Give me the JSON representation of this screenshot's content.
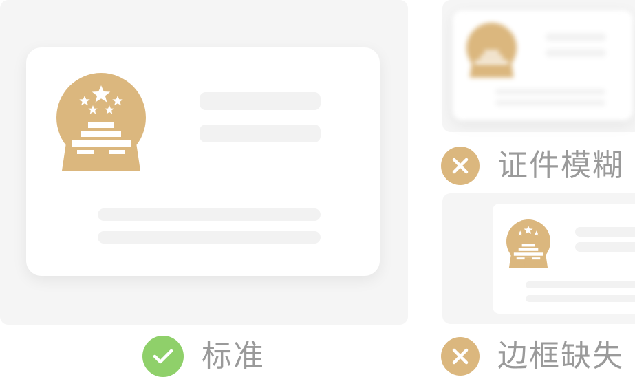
{
  "colors": {
    "gold": "#dbb77e",
    "valid_green": "#8fd06a",
    "panel_gray": "#f5f5f5",
    "bar_gray": "#f2f2f2",
    "label_gray": "#9a9a9a"
  },
  "examples": {
    "standard": {
      "label": "标准",
      "status": "check-icon"
    },
    "blurry": {
      "label": "证件模糊",
      "status": "cross-icon"
    },
    "missing_border": {
      "label": "边框缺失",
      "status": "cross-icon"
    }
  }
}
